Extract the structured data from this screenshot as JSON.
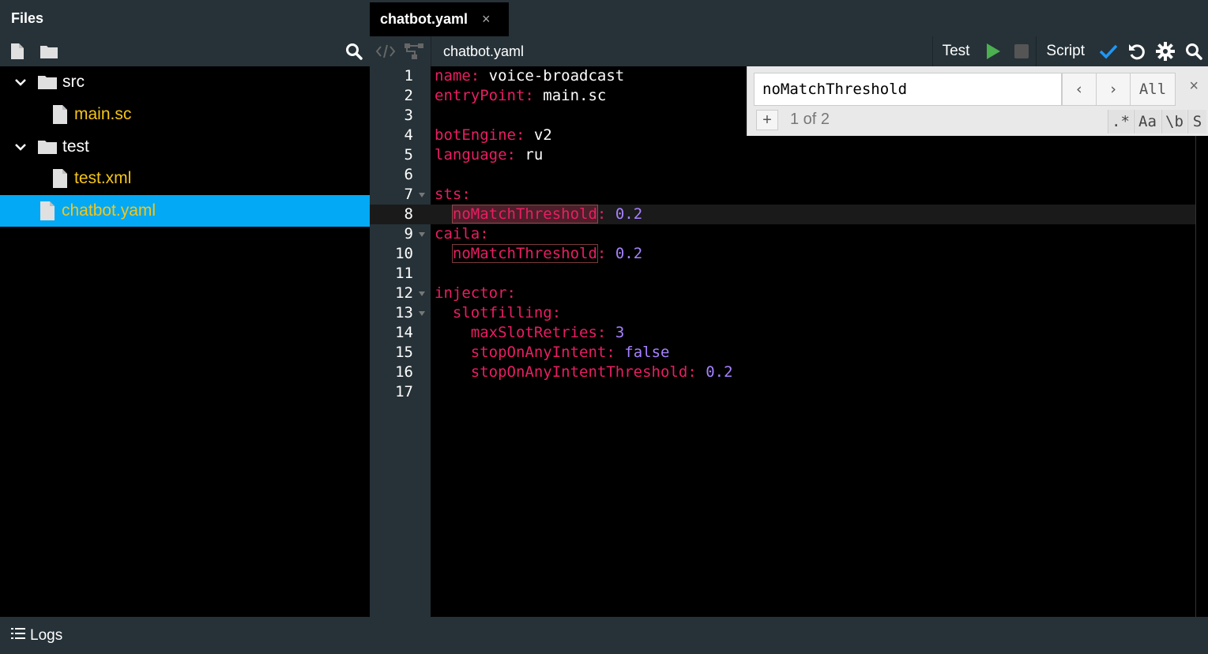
{
  "sidebar": {
    "title": "Files",
    "tree": [
      {
        "type": "folder",
        "name": "src"
      },
      {
        "type": "file",
        "name": "main.sc"
      },
      {
        "type": "folder",
        "name": "test"
      },
      {
        "type": "file",
        "name": "test.xml"
      },
      {
        "type": "file",
        "name": "chatbot.yaml"
      }
    ]
  },
  "tabs": [
    {
      "label": "chatbot.yaml",
      "close": "×"
    }
  ],
  "editor_toolbar": {
    "filename": "chatbot.yaml",
    "test_label": "Test",
    "script_label": "Script"
  },
  "find": {
    "query": "noMatchThreshold",
    "prev": "‹",
    "next": "›",
    "all": "All",
    "close": "×",
    "add": "+",
    "count": "1 of 2",
    "opt_regex": ".*",
    "opt_case": "Aa",
    "opt_word": "\\b",
    "opt_selection": "S"
  },
  "code": {
    "lines": [
      {
        "n": "1",
        "key": "name",
        "val": "voice-broadcast"
      },
      {
        "n": "2",
        "key": "entryPoint",
        "val": "main.sc"
      },
      {
        "n": "3"
      },
      {
        "n": "4",
        "key": "botEngine",
        "val": "v2"
      },
      {
        "n": "5",
        "key": "language",
        "val": "ru"
      },
      {
        "n": "6"
      },
      {
        "n": "7",
        "key": "sts"
      },
      {
        "n": "8",
        "key": "noMatchThreshold",
        "num": "0.2"
      },
      {
        "n": "9",
        "key": "caila"
      },
      {
        "n": "10",
        "key": "noMatchThreshold",
        "num": "0.2"
      },
      {
        "n": "11"
      },
      {
        "n": "12",
        "key": "injector"
      },
      {
        "n": "13",
        "key": "slotfilling"
      },
      {
        "n": "14",
        "key": "maxSlotRetries",
        "num": "3"
      },
      {
        "n": "15",
        "key": "stopOnAnyIntent",
        "num": "false"
      },
      {
        "n": "16",
        "key": "stopOnAnyIntentThreshold",
        "num": "0.2"
      },
      {
        "n": "17"
      }
    ]
  },
  "logs": {
    "label": "Logs"
  },
  "colors": {
    "accent": "#03a9f4",
    "panel": "#263238",
    "key": "#e91e63",
    "number": "#a682ff",
    "filename": "#f5c518",
    "play": "#4caf50",
    "check": "#2196f3"
  }
}
